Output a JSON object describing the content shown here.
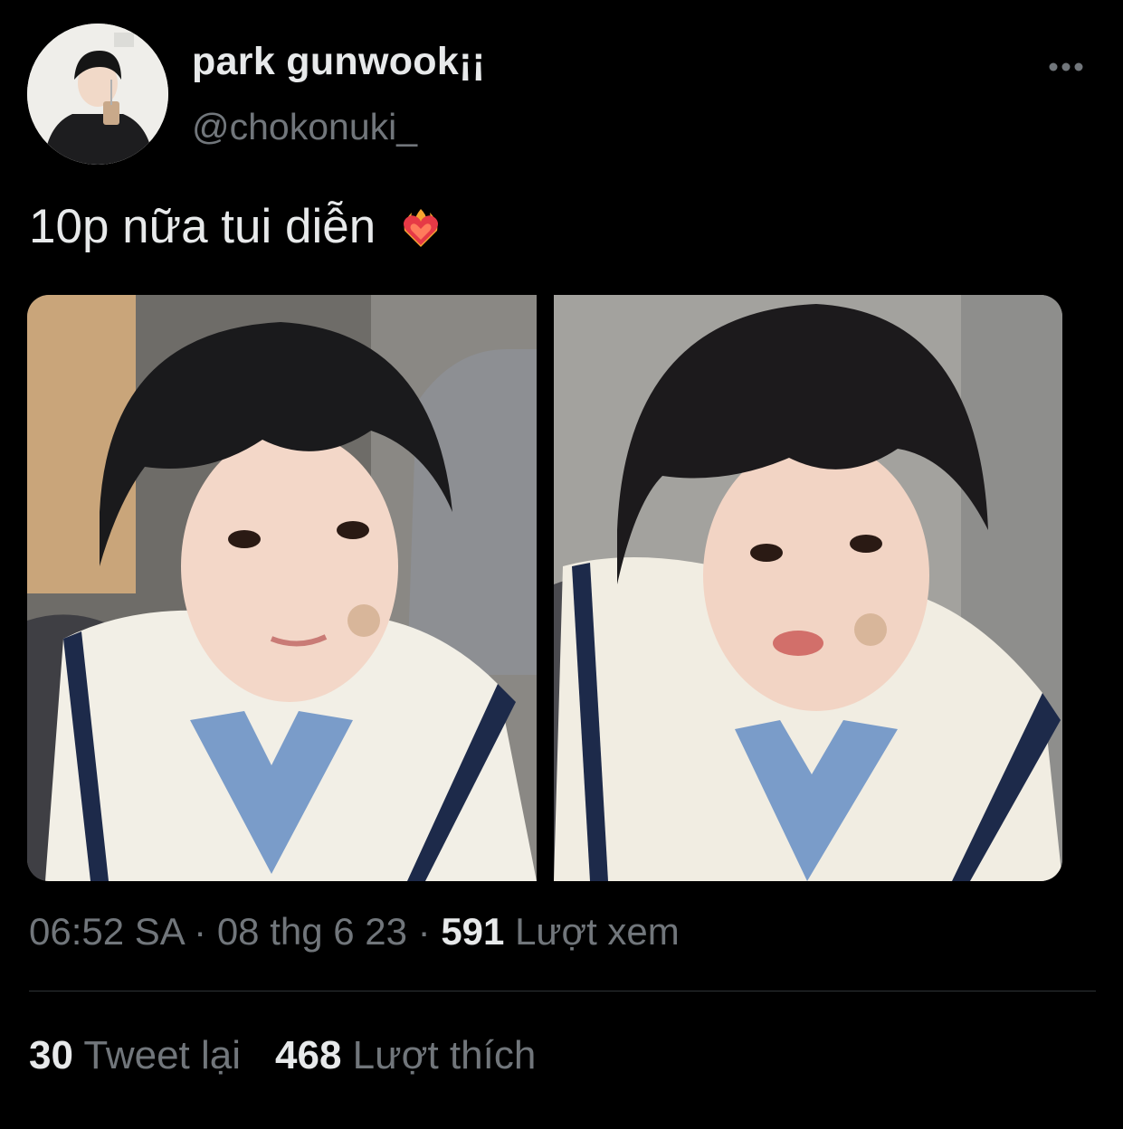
{
  "user": {
    "display_name": "park gunwook¡¡",
    "handle": "@chokonuki_",
    "avatar_icon": "profile-avatar"
  },
  "more_icon": "more-horizontal-icon",
  "tweet": {
    "text": "10p nữa tui diễn",
    "emoji": "heart-on-fire-emoji"
  },
  "media": [
    {
      "name": "tweet-photo-1"
    },
    {
      "name": "tweet-photo-2"
    }
  ],
  "meta": {
    "time": "06:52 SA",
    "sep1": " · ",
    "date": "08 thg 6 23",
    "sep2": " · ",
    "views_count": "591",
    "views_label": " Lượt xem"
  },
  "stats": {
    "retweets_count": "30",
    "retweets_label": " Tweet lại",
    "likes_count": "468",
    "likes_label": " Lượt thích"
  },
  "colors": {
    "background": "#000000",
    "primary_text": "#e7e9ea",
    "secondary_text": "#71767b",
    "divider": "#2f3336"
  }
}
